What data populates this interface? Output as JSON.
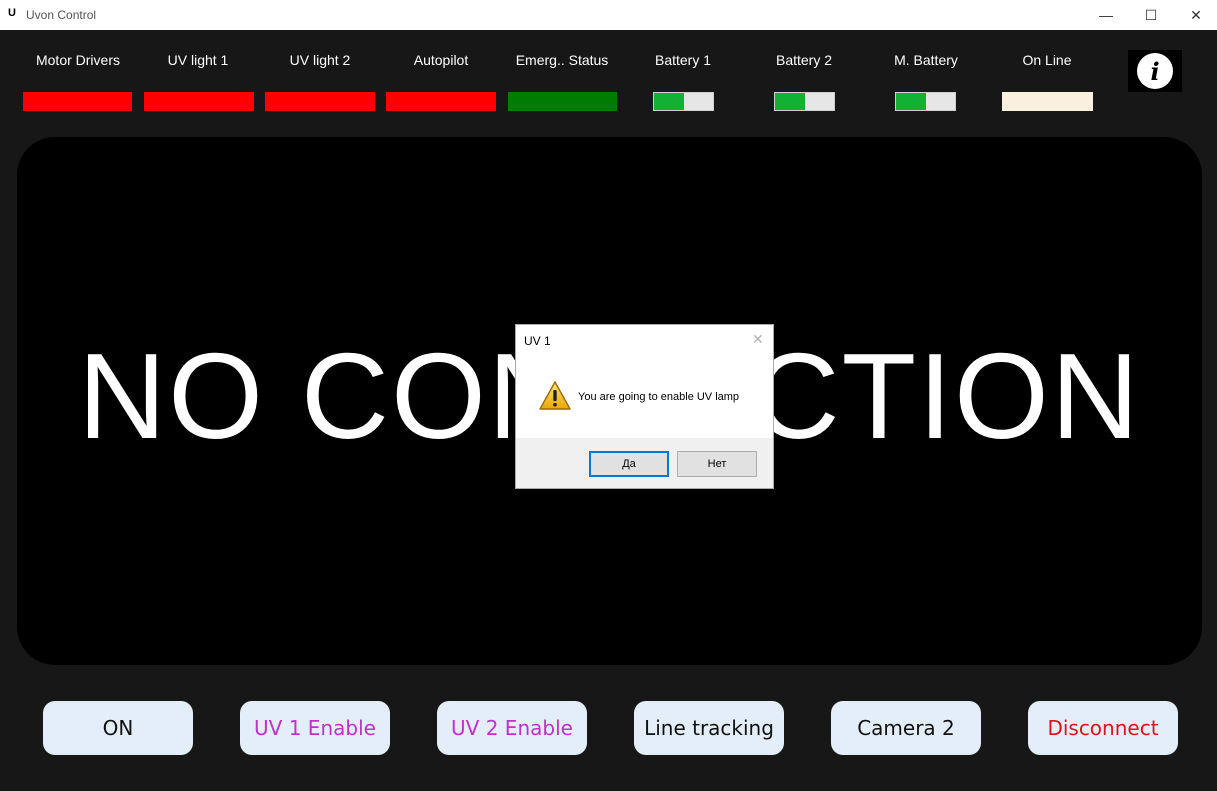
{
  "window": {
    "logo": "U",
    "title": "Uvon Control",
    "minimize": "—",
    "maximize": "☐",
    "close": "✕"
  },
  "status": {
    "labels": [
      "Motor Drivers",
      "UV light 1",
      "UV light 2",
      "Autopilot",
      "Emerg.. Status",
      "Battery 1",
      "Battery 2",
      "M. Battery",
      "On Line"
    ],
    "indicator_colors": {
      "motor_drivers": "#ff0000",
      "uv_light_1": "#ff0000",
      "uv_light_2": "#ff0000",
      "autopilot": "#ff0000",
      "emergency_status": "#007c00",
      "on_line": "#fbf0e0"
    },
    "battery_levels": {
      "battery_1": 0.5,
      "battery_2": 0.5,
      "m_battery": 0.5
    },
    "info_icon": "i"
  },
  "video": {
    "message": "NO CONNECTION"
  },
  "dialog": {
    "title": "UV 1",
    "close": "✕",
    "icon": "warning-icon",
    "message": "You are going to enable UV lamp",
    "yes_label": "Да",
    "no_label": "Нет"
  },
  "buttons": {
    "on": "ON",
    "uv1": "UV 1 Enable",
    "uv2": "UV 2 Enable",
    "line_tracking": "Line tracking",
    "camera2": "Camera 2",
    "disconnect": "Disconnect"
  },
  "colors": {
    "background": "#171717",
    "button_bg": "#e4eefa",
    "uv_text": "#c230c8",
    "disconnect_text": "#e0101c",
    "battery_fill": "#11b135"
  }
}
